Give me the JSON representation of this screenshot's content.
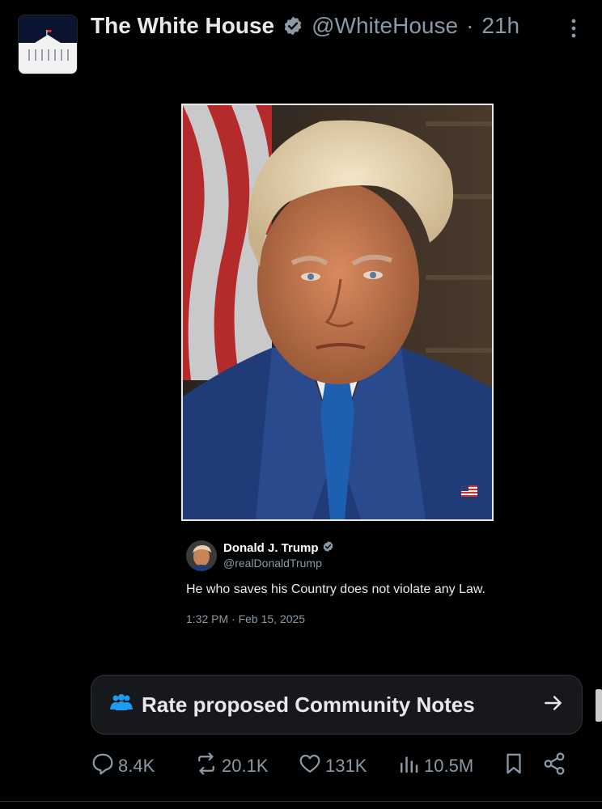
{
  "header": {
    "name": "The White House",
    "handle": "@WhiteHouse",
    "separator": "·",
    "time": "21h"
  },
  "quoted": {
    "name": "Donald J. Trump",
    "handle": "@realDonaldTrump",
    "text": "He who saves his Country does not violate any Law.",
    "timestamp": "1:32 PM · Feb 15, 2025"
  },
  "community_notes": {
    "label": "Rate proposed Community Notes"
  },
  "actions": {
    "replies": "8.4K",
    "reposts": "20.1K",
    "likes": "131K",
    "views": "10.5M"
  },
  "colors": {
    "background": "#000000",
    "text_primary": "#e7e9ea",
    "text_secondary": "#8b98a5",
    "verified": "#8b98a5",
    "accent_blue": "#1d9bf0"
  }
}
